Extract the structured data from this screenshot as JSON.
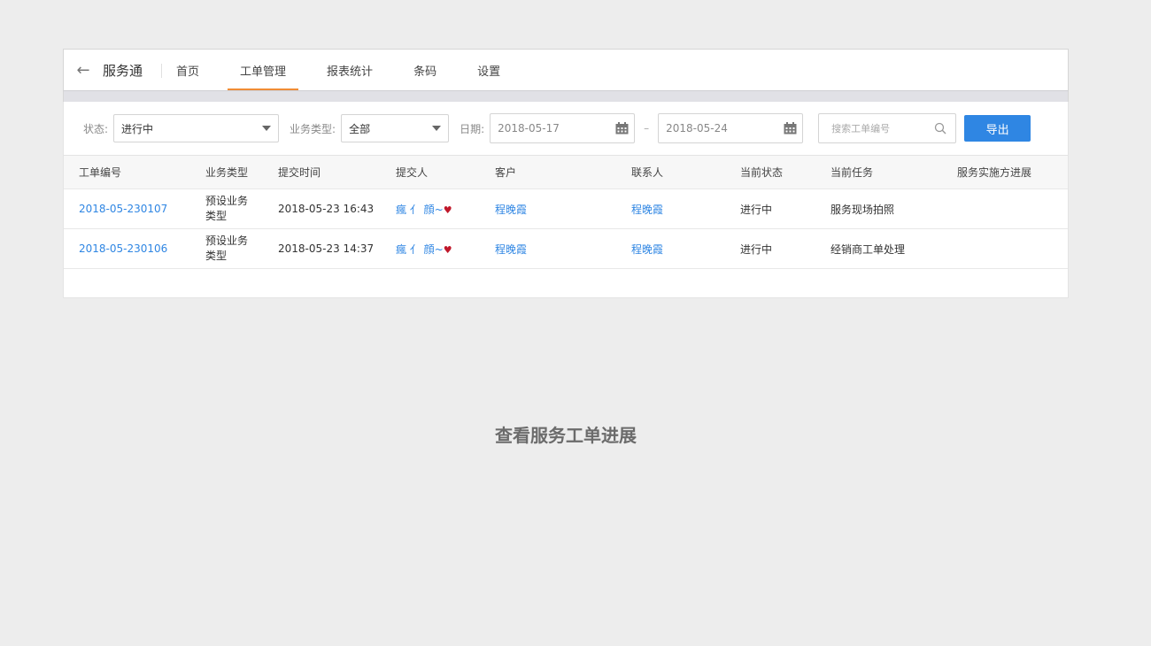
{
  "nav": {
    "back_icon": "arrow-left-icon",
    "brand": "服务通",
    "tabs": [
      {
        "label": "首页",
        "active": false
      },
      {
        "label": "工单管理",
        "active": true
      },
      {
        "label": "报表统计",
        "active": false
      },
      {
        "label": "条码",
        "active": false
      },
      {
        "label": "设置",
        "active": false
      }
    ],
    "active_color": "#f08c35"
  },
  "filters": {
    "status_label": "状态:",
    "status_value": "进行中",
    "type_label": "业务类型:",
    "type_value": "全部",
    "date_label": "日期:",
    "date_from": "2018-05-17",
    "date_sep": "–",
    "date_to": "2018-05-24",
    "search_placeholder": "搜索工单编号",
    "export_label": "导出",
    "accent": "#2f86e3"
  },
  "table": {
    "columns": [
      "工单编号",
      "业务类型",
      "提交时间",
      "提交人",
      "客户",
      "联系人",
      "当前状态",
      "当前任务",
      "服务实施方进展"
    ],
    "rows": [
      {
        "id": "2018-05-230107",
        "type_line1": "预设业务",
        "type_line2": "类型",
        "time": "2018-05-23 16:43",
        "submitter": "瘋 亻 顔~",
        "customer": "程晚霞",
        "contact": "程晚霞",
        "status": "进行中",
        "task": "服务现场拍照",
        "progress": ""
      },
      {
        "id": "2018-05-230106",
        "type_line1": "预设业务",
        "type_line2": "类型",
        "time": "2018-05-23 14:37",
        "submitter": "瘋 亻 顔~",
        "customer": "程晚霞",
        "contact": "程晚霞",
        "status": "进行中",
        "task": "经销商工单处理",
        "progress": ""
      }
    ]
  },
  "caption": "查看服务工单进展"
}
